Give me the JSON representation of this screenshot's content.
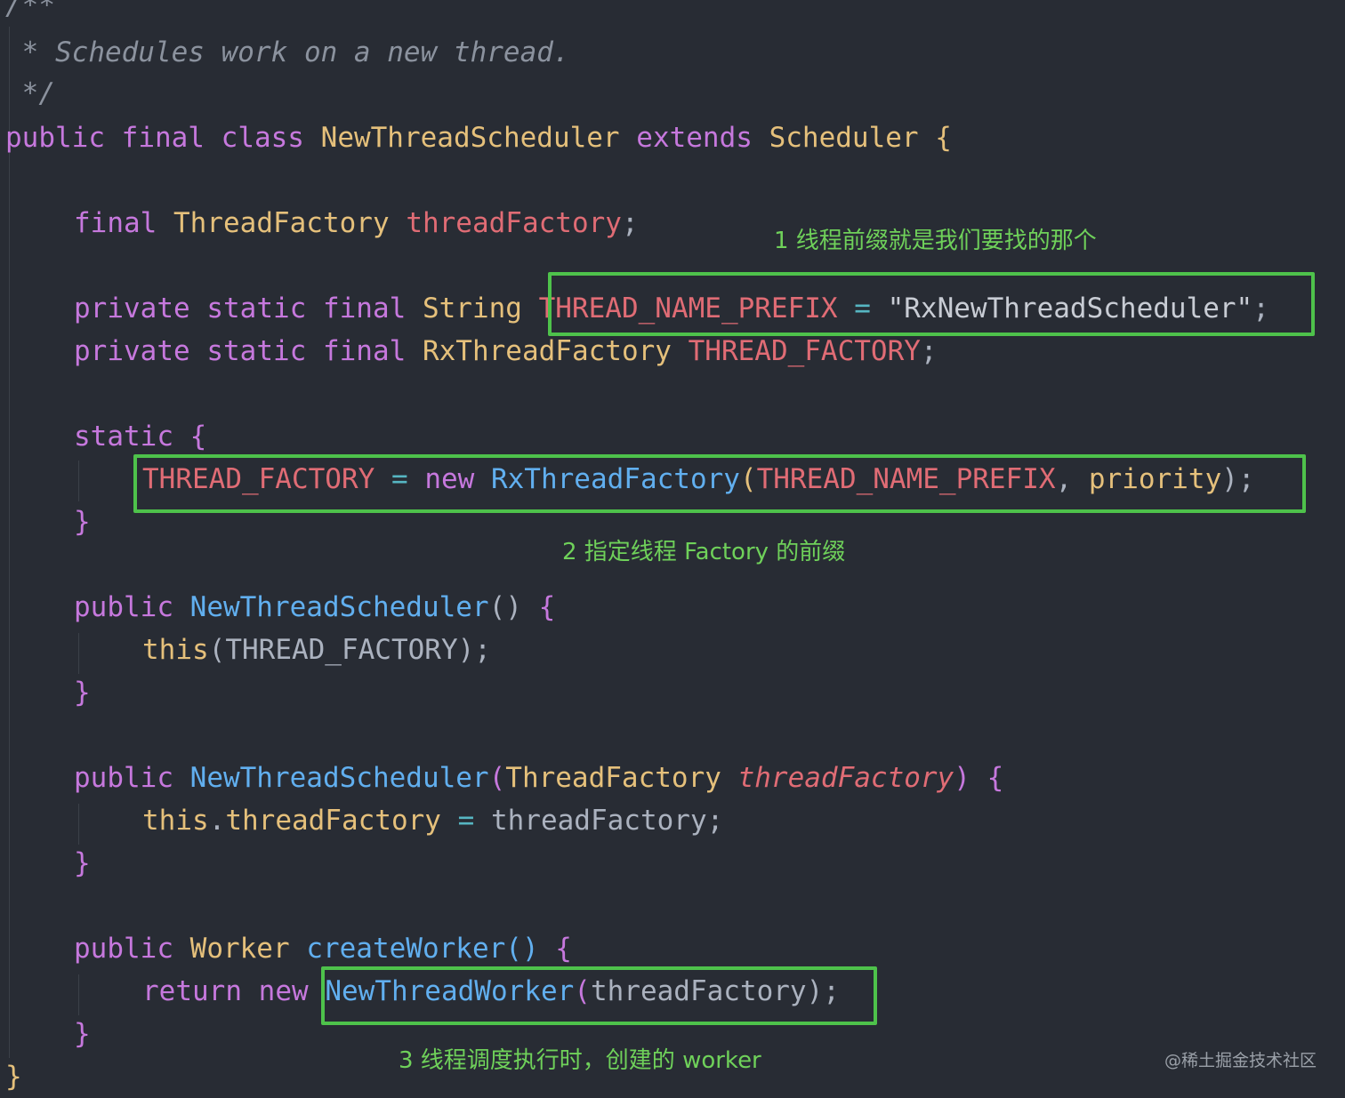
{
  "code": {
    "l0": "/**",
    "l1": " * Schedules work on a new thread.",
    "l2": " */",
    "l3": {
      "kw1": "public",
      "kw2": "final",
      "kw3": "class",
      "name": "NewThreadScheduler",
      "kw4": "extends",
      "base": "Scheduler",
      "brace": "{"
    },
    "l4": {
      "kw": "final",
      "type": "ThreadFactory",
      "field": "threadFactory",
      "semi": ";"
    },
    "l5": {
      "kw1": "private",
      "kw2": "static",
      "kw3": "final",
      "type": "String",
      "const": "THREAD_NAME_PREFIX",
      "eq": "=",
      "str": "\"RxNewThreadScheduler\"",
      "semi": ";"
    },
    "l6": {
      "kw1": "private",
      "kw2": "static",
      "kw3": "final",
      "type": "RxThreadFactory",
      "const": "THREAD_FACTORY",
      "semi": ";"
    },
    "l7": {
      "kw": "static",
      "brace": "{"
    },
    "l8": {
      "const": "THREAD_FACTORY",
      "eq": "=",
      "kw": "new",
      "fn": "RxThreadFactory",
      "open": "(",
      "arg1": "THREAD_NAME_PREFIX",
      "comma": ",",
      "arg2": "priority",
      "close": ");"
    },
    "l9": "}",
    "l10": {
      "kw": "public",
      "fn": "NewThreadScheduler",
      "parens": "()",
      "brace": "{"
    },
    "l11": {
      "kw": "this",
      "open": "(",
      "arg": "THREAD_FACTORY",
      "close": ");"
    },
    "l12": "}",
    "l13": {
      "kw": "public",
      "fn": "NewThreadScheduler",
      "open": "(",
      "type": "ThreadFactory",
      "param": "threadFactory",
      "close": ")",
      "brace": "{"
    },
    "l14": {
      "kw": "this",
      "dot": ".",
      "field": "threadFactory",
      "eq": "=",
      "val": "threadFactory",
      "semi": ";"
    },
    "l15": "}",
    "l16": {
      "kw": "public",
      "type": "Worker",
      "fn": "createWorker",
      "parens": "()",
      "brace": "{"
    },
    "l17": {
      "kw1": "return",
      "kw2": "new",
      "fn": "NewThreadWorker",
      "open": "(",
      "arg": "threadFactory",
      "close": ");"
    },
    "l18": "}",
    "l19": "}"
  },
  "annotations": {
    "note1": "1 线程前缀就是我们要找的那个",
    "note2": "2 指定线程 Factory 的前缀",
    "note3": "3 线程调度执行时，创建的 worker"
  },
  "watermark": "@稀土掘金技术社区",
  "colors": {
    "background": "#282c34",
    "highlight_box": "#4ec24b",
    "annotation_text": "#6fd15a"
  }
}
